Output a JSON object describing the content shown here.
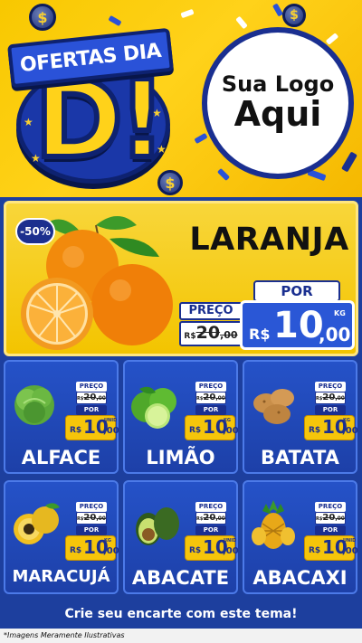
{
  "header": {
    "campaign_ribbon": "OFERTAS DIA",
    "campaign_letter": "D!",
    "logo_line1": "Sua Logo",
    "logo_line2": "Aqui",
    "currency_icon": "$"
  },
  "featured": {
    "discount": "-50%",
    "name": "LARANJA",
    "price_label": "PREÇO",
    "old_currency": "R$",
    "old_int": "20",
    "old_cents": ",00",
    "por_label": "POR",
    "new_currency": "R$",
    "new_int": "10",
    "new_cents": ",00",
    "unit": "KG",
    "image_icon": "orange-icon"
  },
  "products": [
    {
      "name": "ALFACE",
      "price_label": "PREÇO",
      "old_currency": "R$",
      "old_int": "20",
      "old_cents": ",00",
      "por_label": "POR",
      "new_currency": "R$",
      "new_int": "10",
      "new_cents": ",00",
      "unit": "UNID",
      "icon": "lettuce-icon"
    },
    {
      "name": "LIMÃO",
      "price_label": "PREÇO",
      "old_currency": "R$",
      "old_int": "20",
      "old_cents": ",00",
      "por_label": "POR",
      "new_currency": "R$",
      "new_int": "10",
      "new_cents": ",00",
      "unit": "KG",
      "icon": "lime-icon"
    },
    {
      "name": "BATATA",
      "price_label": "PREÇO",
      "old_currency": "R$",
      "old_int": "20",
      "old_cents": ",00",
      "por_label": "POR",
      "new_currency": "R$",
      "new_int": "10",
      "new_cents": ",00",
      "unit": "KG",
      "icon": "potato-icon"
    },
    {
      "name": "MARACUJÁ",
      "price_label": "PREÇO",
      "old_currency": "R$",
      "old_int": "20",
      "old_cents": ",00",
      "por_label": "POR",
      "new_currency": "R$",
      "new_int": "10",
      "new_cents": ",00",
      "unit": "KG",
      "icon": "passion-fruit-icon"
    },
    {
      "name": "ABACATE",
      "price_label": "PREÇO",
      "old_currency": "R$",
      "old_int": "20",
      "old_cents": ",00",
      "por_label": "POR",
      "new_currency": "R$",
      "new_int": "10",
      "new_cents": ",00",
      "unit": "UNID",
      "icon": "avocado-icon"
    },
    {
      "name": "ABACAXI",
      "price_label": "PREÇO",
      "old_currency": "R$",
      "old_int": "20",
      "old_cents": ",00",
      "por_label": "POR",
      "new_currency": "R$",
      "new_int": "10",
      "new_cents": ",00",
      "unit": "UNID",
      "icon": "pineapple-icon"
    }
  ],
  "footer": {
    "cta": "Crie seu encarte com este tema!",
    "disclaimer": "*Imagens Meramente Ilustrativas"
  },
  "colors": {
    "yellow": "#f8c800",
    "blue": "#1d3f9e",
    "dark_blue": "#1a2f90",
    "price_yellow": "#f6c50a"
  }
}
